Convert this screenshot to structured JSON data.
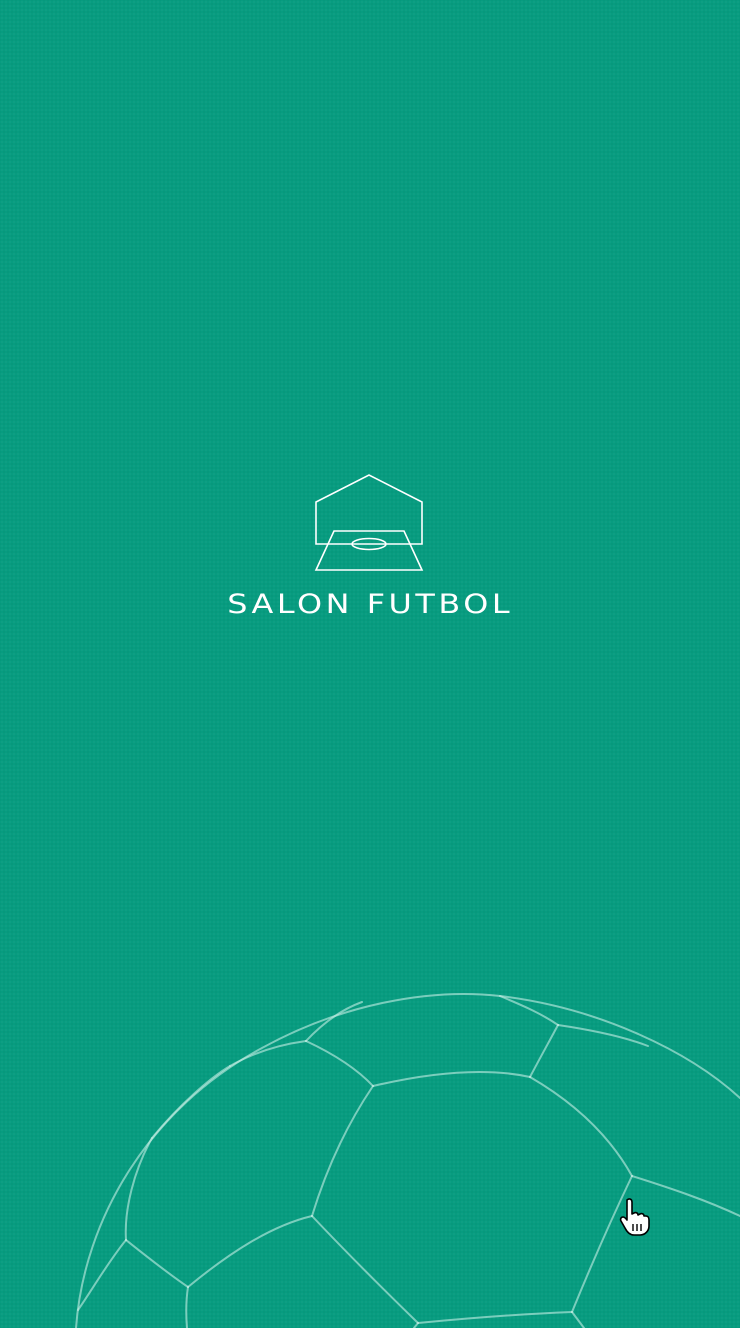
{
  "app": {
    "brand_name": "SALON FUTBOL",
    "logo_icon": "house-with-football-pitch-icon",
    "background_color": "#079c80",
    "accent_color": "#ffffff"
  },
  "decorations": {
    "ball_icon": "soccer-ball-outline-icon",
    "pointer_icon": "hand-pointer-cursor-icon"
  }
}
